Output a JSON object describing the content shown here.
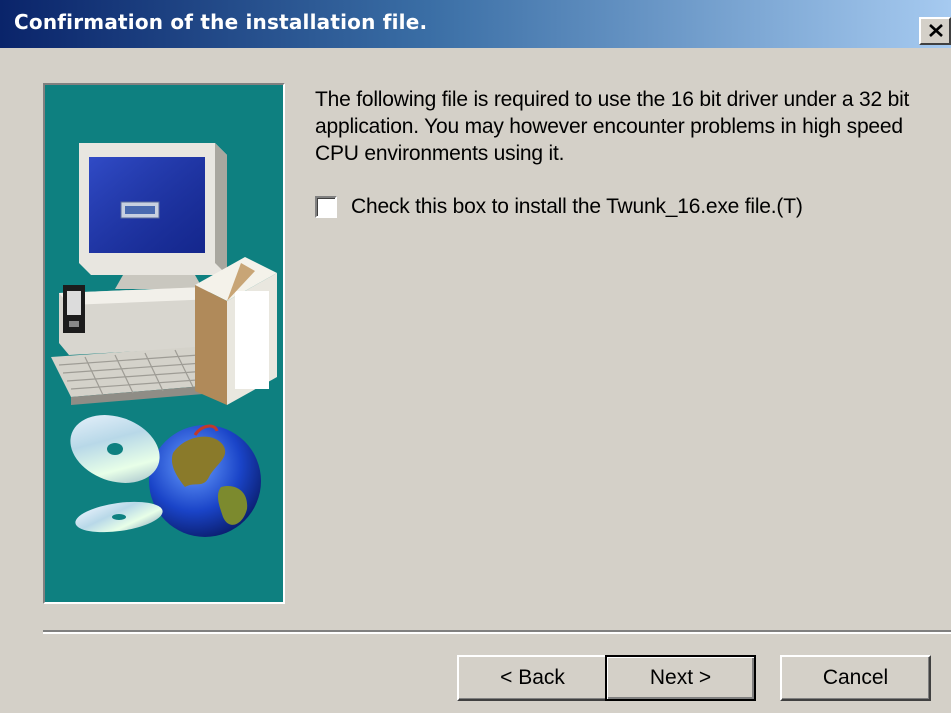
{
  "window": {
    "title": "Confirmation of the installation file.",
    "close_icon": "close-x-icon"
  },
  "content": {
    "description": "The following file is required to use the 16 bit driver under a 32 bit application. You may however encounter problems in high speed CPU environments using it.",
    "checkbox": {
      "label": "Check this box to install the Twunk_16.exe file.(T)",
      "checked": false
    }
  },
  "illustration": {
    "icons": [
      "computer-icon",
      "software-box-icon",
      "cd-disc-icon",
      "globe-icon"
    ]
  },
  "buttons": {
    "back_label": "< Back",
    "next_label": "Next >",
    "cancel_label": "Cancel"
  },
  "colors": {
    "titlebar_start": "#0a246a",
    "titlebar_end": "#a6caf0",
    "illustration_background": "#0e8080",
    "dialog_background": "#d4d0c8"
  }
}
